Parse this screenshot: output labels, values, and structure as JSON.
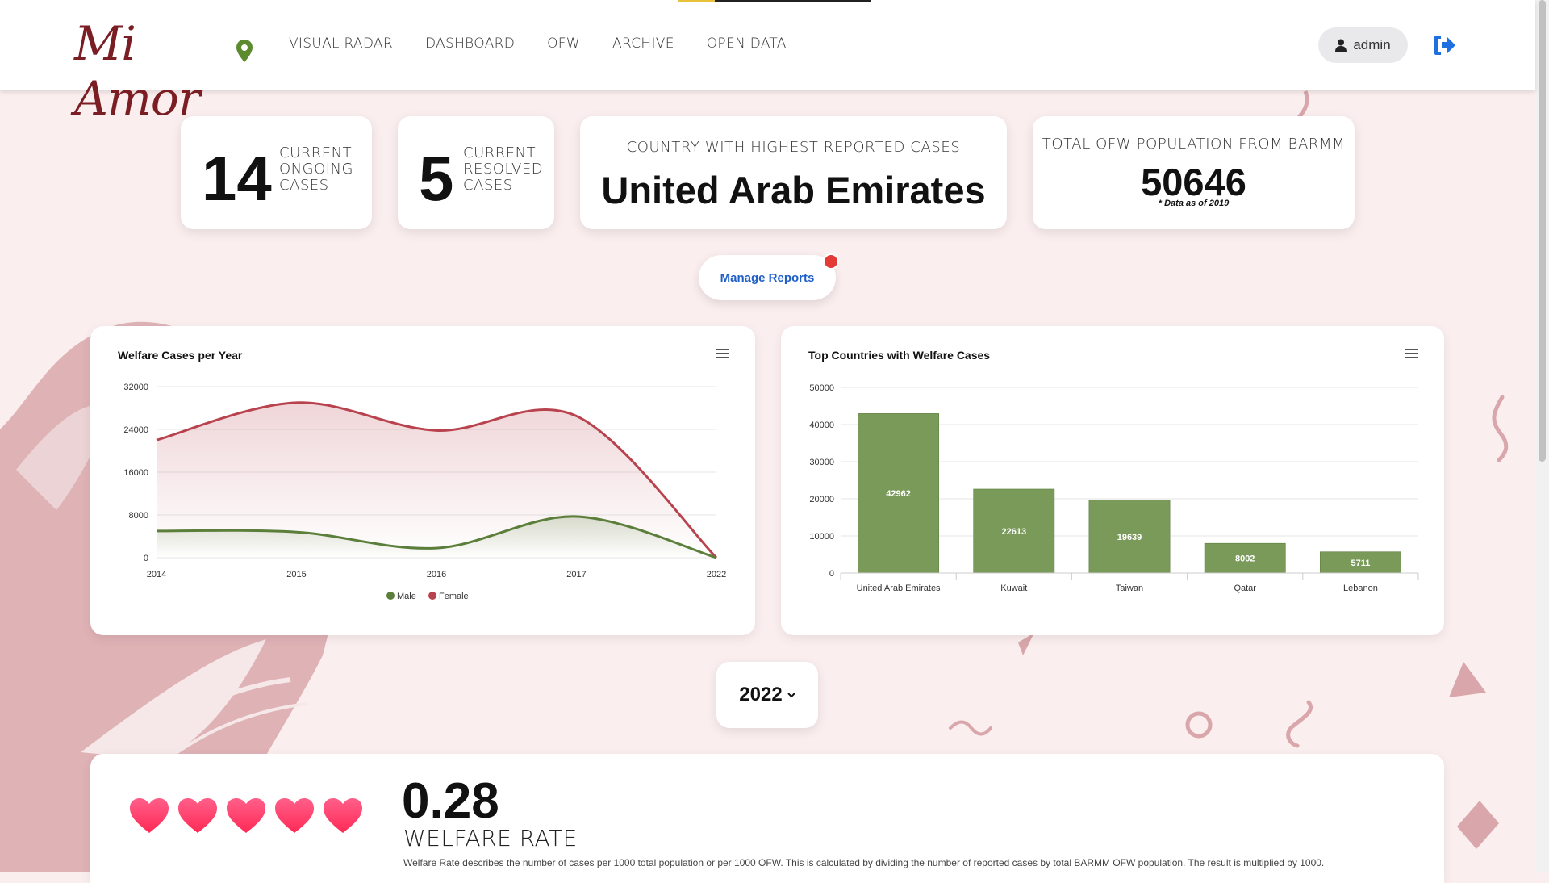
{
  "app": {
    "logo_text": "Mi Amor"
  },
  "nav": {
    "items": [
      "VISUAL RADAR",
      "DASHBOARD",
      "OFW",
      "ARCHIVE",
      "OPEN DATA"
    ]
  },
  "user": {
    "name": "admin"
  },
  "stats": {
    "ongoing": {
      "value": "14",
      "label_lines": [
        "CURRENT",
        "ONGOING",
        "CASES"
      ]
    },
    "resolved": {
      "value": "5",
      "label_lines": [
        "CURRENT",
        "RESOLVED",
        "CASES"
      ]
    },
    "top_country": {
      "title": "COUNTRY WITH HIGHEST REPORTED CASES",
      "value": "United Arab Emirates"
    },
    "population": {
      "title": "TOTAL OFW POPULATION FROM BARMM",
      "value": "50646",
      "note": "* Data as of 2019"
    }
  },
  "manage_reports": {
    "label": "Manage Reports"
  },
  "year_selector": {
    "value": "2022"
  },
  "welfare": {
    "value": "0.28",
    "label": "WELFARE RATE",
    "description": "Welfare Rate describes the number of cases per 1000 total population or per 1000 OFW. This is calculated by dividing the number of reported cases by total BARMM OFW population. The result is multiplied by 1000.",
    "hearts": 5
  },
  "colors": {
    "male": "#5b7f3a",
    "female": "#b8434e",
    "bar": "#7a9a5a",
    "accent": "#1f5fc8",
    "heart_top": "#ff5f8a",
    "heart_bottom": "#ff2a55"
  },
  "chart_data": [
    {
      "type": "line",
      "title": "Welfare Cases per Year",
      "x": [
        "2014",
        "2015",
        "2016",
        "2017",
        "2022"
      ],
      "series": [
        {
          "name": "Male",
          "values": [
            5000,
            4800,
            1800,
            7700,
            0
          ]
        },
        {
          "name": "Female",
          "values": [
            22000,
            29000,
            23800,
            26500,
            0
          ]
        }
      ],
      "y_ticks": [
        "0",
        "8000",
        "16000",
        "24000",
        "32000"
      ],
      "ylim": [
        0,
        32000
      ],
      "legend": "bottom",
      "grid": true
    },
    {
      "type": "bar",
      "title": "Top Countries with Welfare Cases",
      "categories": [
        "United Arab Emirates",
        "Kuwait",
        "Taiwan",
        "Qatar",
        "Lebanon"
      ],
      "values": [
        42962,
        22613,
        19639,
        8002,
        5711
      ],
      "y_ticks": [
        "0",
        "10000",
        "20000",
        "30000",
        "40000",
        "50000"
      ],
      "ylim": [
        0,
        50000
      ],
      "grid": true
    }
  ]
}
